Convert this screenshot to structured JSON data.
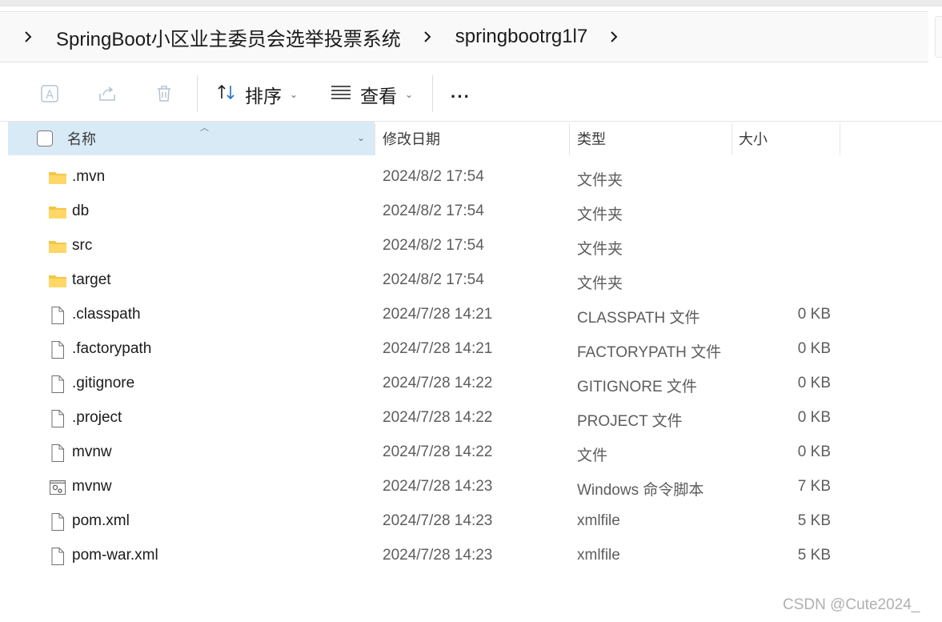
{
  "breadcrumb": {
    "items": [
      "SpringBoot小区业主委员会选举投票系统",
      "springbootrg1l7"
    ]
  },
  "toolbar": {
    "sort_label": "排序",
    "view_label": "查看",
    "more_label": "···",
    "icons": [
      "rename-icon",
      "share-icon",
      "delete-icon"
    ]
  },
  "columns": {
    "name": "名称",
    "modified": "修改日期",
    "type": "类型",
    "size": "大小"
  },
  "files": [
    {
      "icon": "folder-icon",
      "name": ".mvn",
      "modified": "2024/8/2 17:54",
      "type": "文件夹",
      "size": ""
    },
    {
      "icon": "folder-icon",
      "name": "db",
      "modified": "2024/8/2 17:54",
      "type": "文件夹",
      "size": ""
    },
    {
      "icon": "folder-icon",
      "name": "src",
      "modified": "2024/8/2 17:54",
      "type": "文件夹",
      "size": ""
    },
    {
      "icon": "folder-icon",
      "name": "target",
      "modified": "2024/8/2 17:54",
      "type": "文件夹",
      "size": ""
    },
    {
      "icon": "file-icon",
      "name": ".classpath",
      "modified": "2024/7/28 14:21",
      "type": "CLASSPATH 文件",
      "size": "0 KB"
    },
    {
      "icon": "file-icon",
      "name": ".factorypath",
      "modified": "2024/7/28 14:21",
      "type": "FACTORYPATH 文件",
      "size": "0 KB"
    },
    {
      "icon": "file-icon",
      "name": ".gitignore",
      "modified": "2024/7/28 14:22",
      "type": "GITIGNORE 文件",
      "size": "0 KB"
    },
    {
      "icon": "file-icon",
      "name": ".project",
      "modified": "2024/7/28 14:22",
      "type": "PROJECT 文件",
      "size": "0 KB"
    },
    {
      "icon": "file-icon",
      "name": "mvnw",
      "modified": "2024/7/28 14:22",
      "type": "文件",
      "size": "0 KB"
    },
    {
      "icon": "script-icon",
      "name": "mvnw",
      "modified": "2024/7/28 14:23",
      "type": "Windows 命令脚本",
      "size": "7 KB"
    },
    {
      "icon": "file-icon",
      "name": "pom.xml",
      "modified": "2024/7/28 14:23",
      "type": "xmlfile",
      "size": "5 KB"
    },
    {
      "icon": "file-icon",
      "name": "pom-war.xml",
      "modified": "2024/7/28 14:23",
      "type": "xmlfile",
      "size": "5 KB"
    }
  ],
  "watermark": "CSDN @Cute2024_"
}
